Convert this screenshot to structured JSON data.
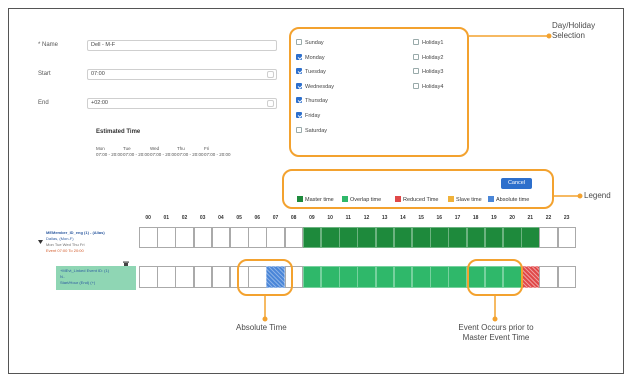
{
  "form": {
    "name_label": "* Name",
    "name_value": "Dell - M-F",
    "start_label": "Start",
    "start_value": "07:00",
    "end_label": "End",
    "end_value": "+02:00",
    "estimated_title": "Estimated Time",
    "estimated": [
      {
        "day": "Mon",
        "time": "07:00 - 20:00"
      },
      {
        "day": "Tue",
        "time": "07:00 - 20:00"
      },
      {
        "day": "Wed",
        "time": "07:00 - 20:00"
      },
      {
        "day": "Thu",
        "time": "07:00 - 20:00"
      },
      {
        "day": "Fri",
        "time": "07:00 - 20:00"
      }
    ]
  },
  "days": [
    {
      "label": "Sunday",
      "checked": false
    },
    {
      "label": "Monday",
      "checked": true
    },
    {
      "label": "Tuesday",
      "checked": true
    },
    {
      "label": "Wednesday",
      "checked": true
    },
    {
      "label": "Thursday",
      "checked": true
    },
    {
      "label": "Friday",
      "checked": true
    },
    {
      "label": "Saturday",
      "checked": false
    }
  ],
  "holidays": [
    {
      "label": "Holiday1",
      "checked": false
    },
    {
      "label": "Holiday2",
      "checked": false
    },
    {
      "label": "Holiday3",
      "checked": false
    },
    {
      "label": "Holiday4",
      "checked": false
    }
  ],
  "cancel_label": "Cancel",
  "legend": [
    {
      "label": "Master time",
      "color": "#1e8a3c"
    },
    {
      "label": "Overlap time",
      "color": "#2fb86a"
    },
    {
      "label": "Reduced Time",
      "color": "#e04848"
    },
    {
      "label": "Slave time",
      "color": "#f0b23a"
    },
    {
      "label": "Absolute time",
      "color": "#4a86d8"
    }
  ],
  "hours": [
    "00",
    "01",
    "02",
    "03",
    "04",
    "05",
    "06",
    "07",
    "08",
    "09",
    "10",
    "11",
    "12",
    "13",
    "14",
    "15",
    "16",
    "17",
    "18",
    "19",
    "20",
    "21",
    "22",
    "23"
  ],
  "row1": {
    "title": "MEMember_ID_eng (1) - (Alias)",
    "line2": "Dallas, (Mon-F)",
    "line3": "Mon Tue Wed Thu Fri",
    "line4": "Event 07:00 To 20:00",
    "master_hours": [
      9,
      10,
      11,
      12,
      13,
      14,
      15,
      16,
      17,
      18,
      19,
      20,
      21
    ]
  },
  "row2": {
    "title": "+MEvt_Linked Event ID: (1)",
    "line2": "N..",
    "line3": "Start/Hour (End) (+)",
    "absolute_hours": [
      7
    ],
    "overlap_hours": [
      9,
      10,
      11,
      12,
      13,
      14,
      15,
      16,
      17,
      18,
      19,
      20
    ],
    "reduced_hours": [
      21
    ]
  },
  "annotations": {
    "day_holiday": [
      "Day/Holiday",
      "Selection"
    ],
    "legend": "Legend",
    "absolute_time": "Absolute Time",
    "event_prior": [
      "Event Occurs prior to",
      "Master Event Time"
    ]
  },
  "colors": {
    "accent": "#2d6fcc",
    "callout": "#f3a22f",
    "master": "#1e8a3c",
    "overlap": "#2fb86a",
    "reduced": "#e04848",
    "absolute": "#4a86d8",
    "row2_label_bg": "#8fd6b4"
  }
}
